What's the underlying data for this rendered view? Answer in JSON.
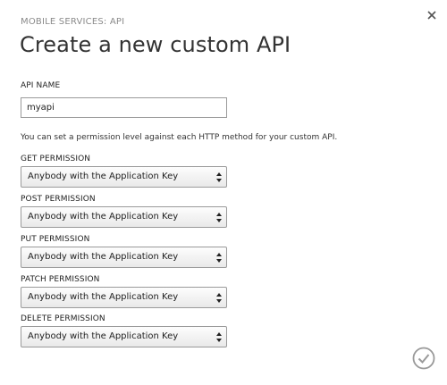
{
  "dialog": {
    "breadcrumb": "MOBILE SERVICES: API",
    "title": "Create a new custom API",
    "close_icon": "close-icon",
    "confirm_icon": "checkmark-circle-icon"
  },
  "api_name": {
    "label": "API NAME",
    "value": "myapi"
  },
  "help_text": "You can set a permission level against each HTTP method for your custom API.",
  "permissions": [
    {
      "label": "GET PERMISSION",
      "value": "Anybody with the Application Key"
    },
    {
      "label": "POST PERMISSION",
      "value": "Anybody with the Application Key"
    },
    {
      "label": "PUT PERMISSION",
      "value": "Anybody with the Application Key"
    },
    {
      "label": "PATCH PERMISSION",
      "value": "Anybody with the Application Key"
    },
    {
      "label": "DELETE PERMISSION",
      "value": "Anybody with the Application Key"
    }
  ],
  "colors": {
    "confirm_button": "#9a9a9a",
    "input_border": "#9a9a9a"
  }
}
